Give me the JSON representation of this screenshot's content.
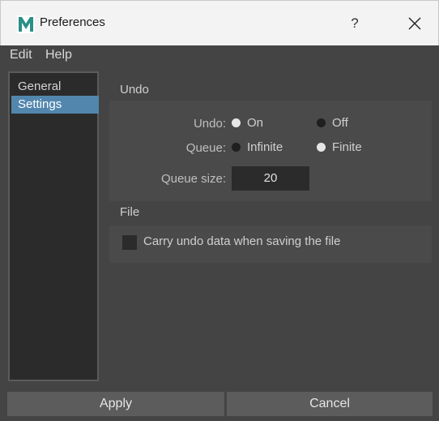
{
  "window": {
    "title": "Preferences",
    "help": "?"
  },
  "menu": {
    "edit": "Edit",
    "help": "Help"
  },
  "categories": [
    {
      "label": "General",
      "selected": false
    },
    {
      "label": "Settings",
      "selected": true
    }
  ],
  "undo_section": {
    "title": "Undo",
    "undo_label": "Undo:",
    "undo_on": "On",
    "undo_off": "Off",
    "undo_value": "On",
    "queue_label": "Queue:",
    "queue_infinite": "Infinite",
    "queue_finite": "Finite",
    "queue_value": "Finite",
    "queue_size_label": "Queue size:",
    "queue_size_value": "20"
  },
  "file_section": {
    "title": "File",
    "carry_undo_label": "Carry undo data when saving the file",
    "carry_undo_checked": false
  },
  "buttons": {
    "apply": "Apply",
    "cancel": "Cancel"
  },
  "colors": {
    "accent": "#5286ad",
    "window_bg": "#444444",
    "field_bg": "#2b2b2b",
    "app_icon": "#2a8f86"
  },
  "icons": {
    "app": "maya-m-icon",
    "close": "close-icon"
  }
}
